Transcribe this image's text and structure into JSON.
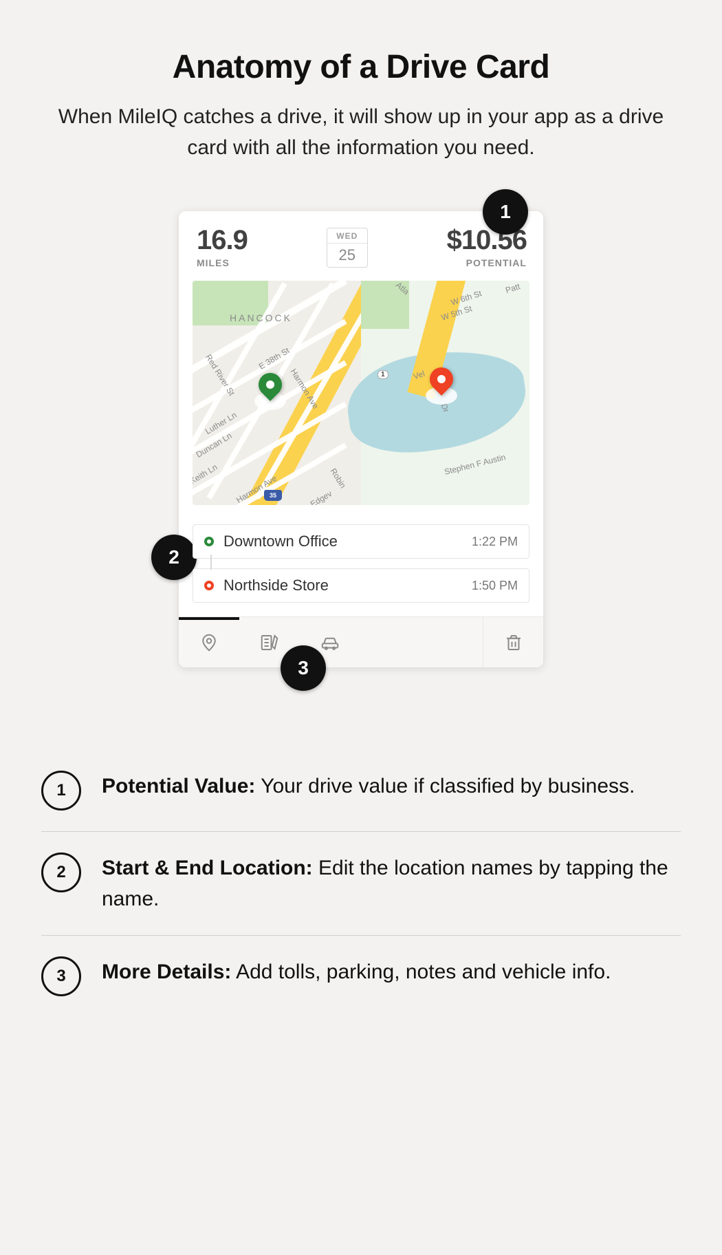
{
  "title": "Anatomy of a Drive Card",
  "subtitle": "When MileIQ catches a drive, it will show up in your app as a drive card with all the information you need.",
  "card": {
    "miles": {
      "value": "16.9",
      "label": "MILES"
    },
    "date": {
      "dow": "WED",
      "day": "25"
    },
    "potential": {
      "value": "$10.56",
      "label": "POTENTIAL"
    },
    "map": {
      "left_label": "HANCOCK",
      "streets_left": {
        "e38": "E 38th St",
        "redriver": "Red River St",
        "harmon": "Harmon Ave",
        "luther": "Luther Ln",
        "duncan": "Duncan Ln",
        "keith": "Keith Ln",
        "harmon2": "Harmon Ave",
        "edge": "Edgev",
        "robin": "Robin"
      },
      "streets_right": {
        "atla": "Atla",
        "w6": "W 6th St",
        "w5": "W 5th St",
        "patt": "Patt",
        "vel": "Vel",
        "dr": "Dr",
        "saustin": "Stephen F Austin"
      },
      "route1": "1",
      "i35": "35"
    },
    "locations": [
      {
        "name": "Downtown Office",
        "time": "1:22 PM",
        "color": "green"
      },
      {
        "name": "Northside Store",
        "time": "1:50 PM",
        "color": "red"
      }
    ]
  },
  "badges": {
    "b1": "1",
    "b2": "2",
    "b3": "3"
  },
  "legend": [
    {
      "num": "1",
      "title": "Potential Value:",
      "desc": " Your drive value if classified by business."
    },
    {
      "num": "2",
      "title": "Start & End Location:",
      "desc": " Edit the location names by tapping the name."
    },
    {
      "num": "3",
      "title": "More Details:",
      "desc": " Add tolls, parking, notes and vehicle info."
    }
  ]
}
